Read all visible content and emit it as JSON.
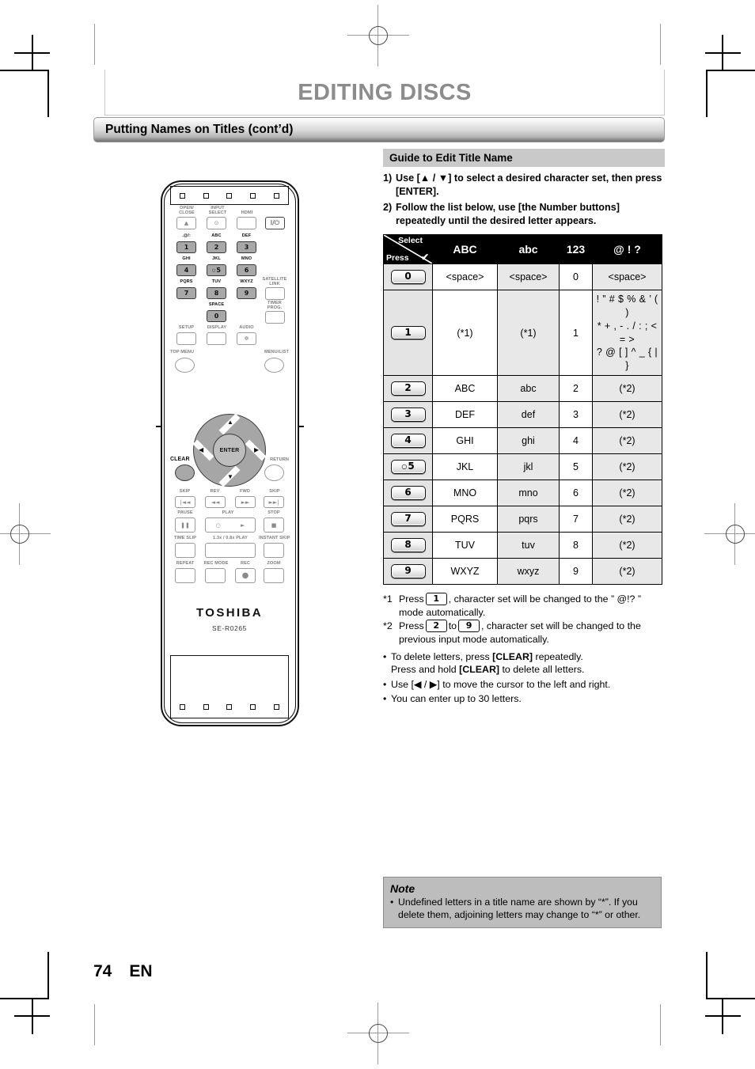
{
  "chapter_title": "EDITING DISCS",
  "section_title": "Putting Names on Titles (cont’d)",
  "guide": {
    "heading": "Guide to Edit Title Name",
    "steps": [
      {
        "num": "1)",
        "text": "Use [▲ / ▼] to select a desired character set, then press [ENTER]."
      },
      {
        "num": "2)",
        "text": "Follow the list below, use [the Number buttons] repeatedly until the desired letter appears."
      }
    ]
  },
  "table": {
    "corner": {
      "select": "Select",
      "press": "Press",
      "check": "✔"
    },
    "headers": [
      "ABC",
      "abc",
      "123",
      "@ ! ?"
    ],
    "rows": [
      {
        "key": "0",
        "abc": "<space>",
        "lower": "<space>",
        "num": "0",
        "sym": "<space>"
      },
      {
        "key": "1",
        "abc": "(*1)",
        "lower": "(*1)",
        "num": "1",
        "sym": "! ” # $ % & ’ ( )\n* + , - . / : ; < = >\n? @ [ ] ^ _ { | }"
      },
      {
        "key": "2",
        "abc": "ABC",
        "lower": "abc",
        "num": "2",
        "sym": "(*2)"
      },
      {
        "key": "3",
        "abc": "DEF",
        "lower": "def",
        "num": "3",
        "sym": "(*2)"
      },
      {
        "key": "4",
        "abc": "GHI",
        "lower": "ghi",
        "num": "4",
        "sym": "(*2)"
      },
      {
        "key": "5",
        "abc": "JKL",
        "lower": "jkl",
        "num": "5",
        "sym": "(*2)"
      },
      {
        "key": "6",
        "abc": "MNO",
        "lower": "mno",
        "num": "6",
        "sym": "(*2)"
      },
      {
        "key": "7",
        "abc": "PQRS",
        "lower": "pqrs",
        "num": "7",
        "sym": "(*2)"
      },
      {
        "key": "8",
        "abc": "TUV",
        "lower": "tuv",
        "num": "8",
        "sym": "(*2)"
      },
      {
        "key": "9",
        "abc": "WXYZ",
        "lower": "wxyz",
        "num": "9",
        "sym": "(*2)"
      }
    ]
  },
  "footnotes": {
    "fn1_mark": "*1",
    "fn1_a": "Press",
    "fn1_key": "1",
    "fn1_b": ", character set will be changed to the ” @!? ” mode automatically.",
    "fn2_mark": "*2",
    "fn2_a": "Press",
    "fn2_key1": "2",
    "fn2_mid": "to",
    "fn2_key2": "9",
    "fn2_b": ", character set will be changed to the previous input mode automatically."
  },
  "bullets": [
    {
      "dot": "•",
      "a": "To delete letters, press ",
      "b": "[CLEAR]",
      "c": " repeatedly.",
      "d": "Press and hold ",
      "e": "[CLEAR]",
      "f": " to delete all letters."
    },
    {
      "dot": "•",
      "a": "Use [◀ / ▶] to move the cursor to the left and right."
    },
    {
      "dot": "•",
      "a": "You can enter up to 30 letters."
    }
  ],
  "note": {
    "title": "Note",
    "dot": "•",
    "text": "Undefined letters in a title name are shown by “*”. If you delete them, adjoining letters may change to “*” or other."
  },
  "footer": {
    "page_number": "74",
    "language": "EN"
  },
  "remote": {
    "brand": "TOSHIBA",
    "model": "SE-R0265",
    "labels": {
      "open_close": "OPEN/\nCLOSE",
      "input_select": "INPUT\nSELECT",
      "hdmi": "HDMI",
      "power": "I/⏻",
      "k1": ".@/:",
      "k2": "ABC",
      "k3": "DEF",
      "k4": "GHI",
      "k5": "JKL",
      "k6": "MNO",
      "k7": "PQRS",
      "k8": "TUV",
      "k9": "WXYZ",
      "k0": "SPACE",
      "satellite_link": "SATELLITE\nLINK",
      "timer_prog": "TIMER\nPROG.",
      "setup": "SETUP",
      "display": "DISPLAY",
      "audio": "AUDIO",
      "top_menu": "TOP MENU",
      "menu_list": "MENU/LIST",
      "clear": "CLEAR",
      "return": "RETURN",
      "enter": "ENTER",
      "skip_back": "SKIP",
      "rev": "REV",
      "fwd": "FWD",
      "skip_fwd": "SKIP",
      "pause": "PAUSE",
      "play": "PLAY",
      "stop": "STOP",
      "time_slip": "TIME SLIP",
      "speed_play": "1.3x / 0.8x PLAY",
      "instant_skip": "INSTANT SKIP",
      "repeat": "REPEAT",
      "rec_mode": "REC MODE",
      "rec": "REC",
      "zoom": "ZOOM"
    },
    "keypad": [
      "1",
      "2",
      "3",
      "4",
      "5",
      "6",
      "7",
      "8",
      "9",
      "0"
    ]
  }
}
